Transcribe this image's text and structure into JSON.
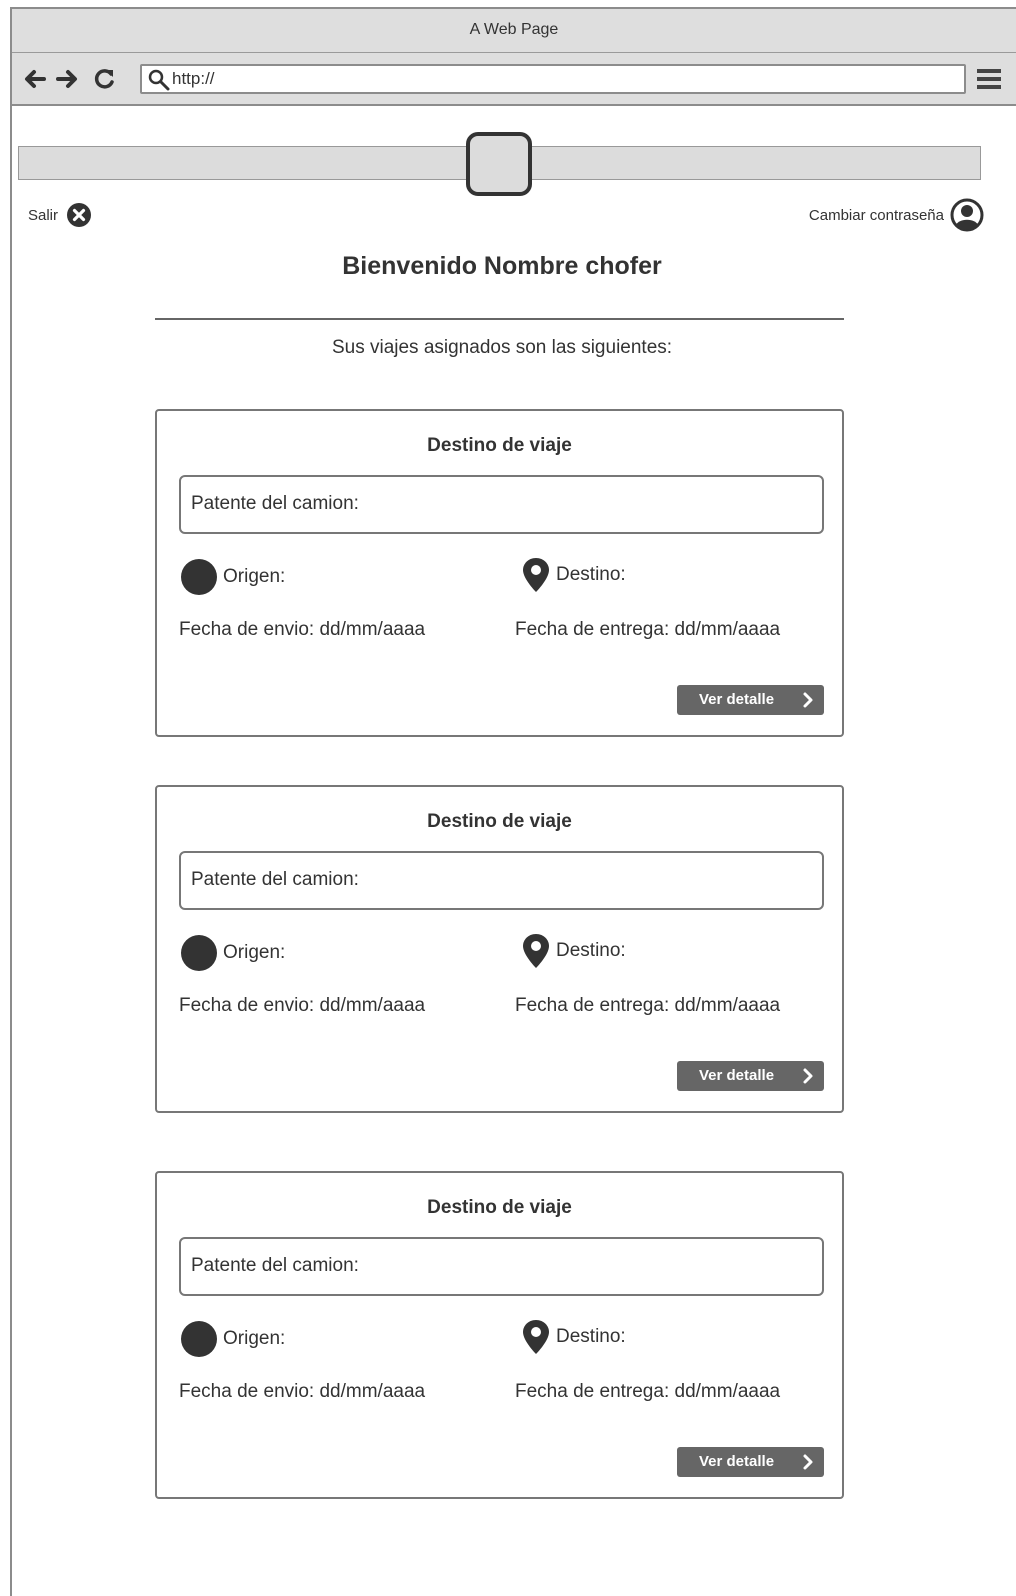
{
  "window": {
    "title": "A Web Page"
  },
  "toolbar": {
    "url": "http://"
  },
  "header": {
    "logout_label": "Salir",
    "change_password_label": "Cambiar contraseña"
  },
  "main": {
    "welcome": "Bienvenido Nombre chofer",
    "subtitle": "Sus viajes asignados son las siguientes:"
  },
  "trips": [
    {
      "title": "Destino de viaje",
      "plate_label": "Patente del camion:",
      "origin_label": "Origen:",
      "destination_label": "Destino:",
      "send_date": "Fecha de envio:  dd/mm/aaaa",
      "delivery_date": "Fecha de entrega: dd/mm/aaaa",
      "detail_button": "Ver detalle"
    },
    {
      "title": "Destino de viaje",
      "plate_label": "Patente del camion:",
      "origin_label": "Origen:",
      "destination_label": "Destino:",
      "send_date": "Fecha de envio:  dd/mm/aaaa",
      "delivery_date": "Fecha de entrega: dd/mm/aaaa",
      "detail_button": "Ver detalle"
    },
    {
      "title": "Destino de viaje",
      "plate_label": "Patente del camion:",
      "origin_label": "Origen:",
      "destination_label": "Destino:",
      "send_date": "Fecha de envio:  dd/mm/aaaa",
      "delivery_date": "Fecha de entrega: dd/mm/aaaa",
      "detail_button": "Ver detalle"
    }
  ],
  "icons": {
    "back": "arrow-left-icon",
    "forward": "arrow-right-icon",
    "reload": "reload-icon",
    "search": "search-icon",
    "menu": "hamburger-menu-icon",
    "logout": "close-circle-icon",
    "account": "user-circle-icon",
    "origin": "filled-circle-icon",
    "destination": "map-pin-icon",
    "detail": "chevron-right-icon"
  }
}
